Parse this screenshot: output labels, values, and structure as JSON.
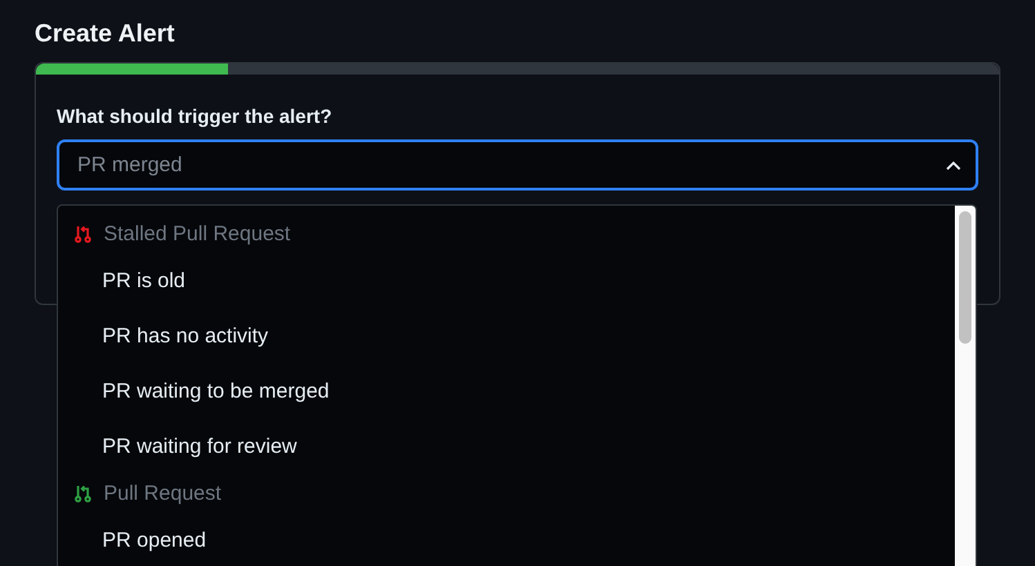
{
  "title": "Create Alert",
  "progress": {
    "level": 0.2
  },
  "question": "What should trigger the alert?",
  "select": {
    "placeholder": "PR merged",
    "expanded": true
  },
  "options": [
    {
      "label": "Stalled Pull Request",
      "color": "#e5191f",
      "children": [
        {
          "label": "PR is old"
        },
        {
          "label": "PR has no activity"
        },
        {
          "label": "PR waiting to be merged"
        },
        {
          "label": "PR waiting for review"
        }
      ]
    },
    {
      "label": "Pull Request",
      "color": "#2ea043",
      "children": [
        {
          "label": "PR opened"
        }
      ]
    }
  ]
}
